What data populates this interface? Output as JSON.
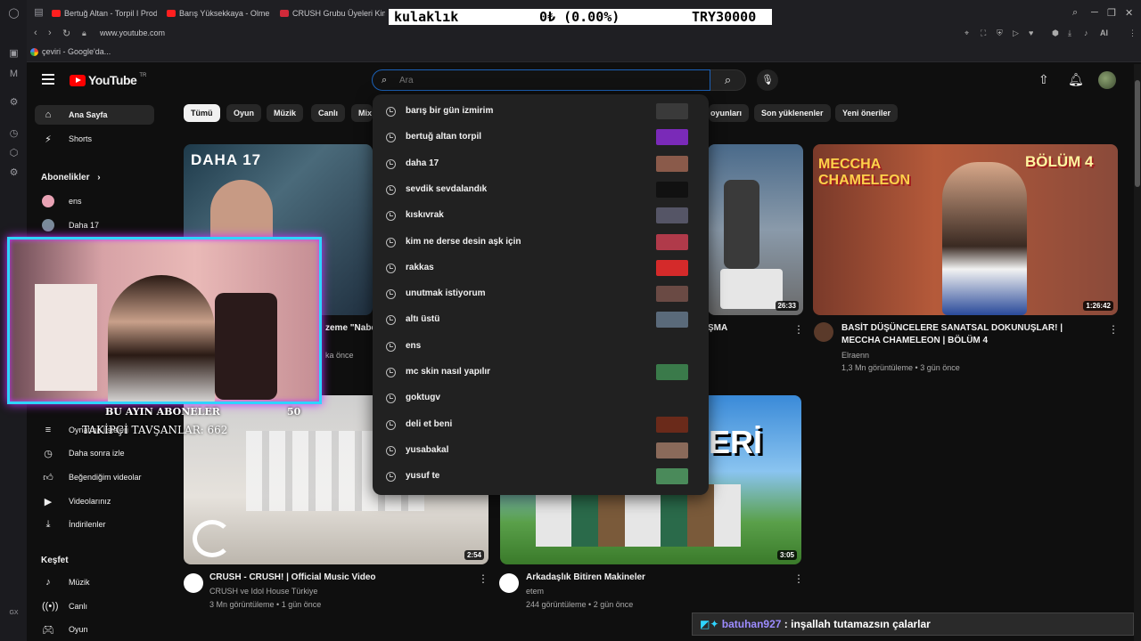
{
  "browser": {
    "tabs": [
      {
        "label": "Bertuğ Altan - Torpil I Prod"
      },
      {
        "label": "Barış Yüksekkaya - Olmeli"
      },
      {
        "label": "CRUSH Grubu Üyeleri Kim"
      }
    ],
    "ticker": {
      "term": "kulaklık",
      "change": "0₺ (0.00%)",
      "price": "TRY30000"
    },
    "url": "www.youtube.com",
    "bookmark": "çeviri - Google'da..."
  },
  "masthead": {
    "logo_text": "YouTube",
    "logo_sup": "TR",
    "search_placeholder": "Ara"
  },
  "sidebar": {
    "main": [
      {
        "label": "Ana Sayfa",
        "icon": "home-icon"
      },
      {
        "label": "Shorts",
        "icon": "shorts-icon"
      }
    ],
    "subs_heading": "Abonelikler",
    "subs": [
      {
        "label": "ens",
        "color": "#e8a2b4"
      },
      {
        "label": "Daha 17",
        "color": "#7a8b9a"
      }
    ],
    "you": [
      {
        "label": "Oynatma listeleri",
        "icon": "playlist-icon"
      },
      {
        "label": "Daha sonra izle",
        "icon": "clock-icon"
      },
      {
        "label": "Beğendiğim videolar",
        "icon": "thumbs-up-icon"
      },
      {
        "label": "Videolarınız",
        "icon": "video-icon"
      },
      {
        "label": "İndirilenler",
        "icon": "download-icon"
      }
    ],
    "explore_heading": "Keşfet",
    "explore": [
      {
        "label": "Müzik",
        "icon": "music-icon"
      },
      {
        "label": "Canlı",
        "icon": "live-icon"
      },
      {
        "label": "Oyun",
        "icon": "game-icon"
      }
    ]
  },
  "chips": {
    "left": [
      "Tümü",
      "Oyun",
      "Müzik",
      "Canlı",
      "Mix"
    ],
    "right": [
      "oyunları",
      "Son yüklenenler",
      "Yeni öneriler"
    ]
  },
  "suggestions": [
    {
      "text": "barış bir gün izmirim",
      "thumb": "#3a3a3a"
    },
    {
      "text": "bertuğ altan torpil",
      "thumb": "#7a2ab8"
    },
    {
      "text": "daha 17",
      "thumb": "#8a5a4a"
    },
    {
      "text": "sevdik sevdalandık",
      "thumb": "#111111"
    },
    {
      "text": "kıskıvrak",
      "thumb": "#555566"
    },
    {
      "text": "kim ne derse desin aşk için",
      "thumb": "#b03a4a"
    },
    {
      "text": "rakkas",
      "thumb": "#d42a2a"
    },
    {
      "text": "unutmak istiyorum",
      "thumb": "#6a4a44"
    },
    {
      "text": "altı üstü",
      "thumb": "#5a6a7a"
    },
    {
      "text": "ens",
      "thumb": ""
    },
    {
      "text": "mc skin nasıl yapılır",
      "thumb": "#3a7a4a"
    },
    {
      "text": "goktugv",
      "thumb": ""
    },
    {
      "text": "deli et beni",
      "thumb": "#6a2a1a"
    },
    {
      "text": "yusabakal",
      "thumb": "#8a6a5a"
    },
    {
      "text": "yusuf te",
      "thumb": "#4a8a5a"
    }
  ],
  "videos": {
    "row1_left": {
      "thumb_text": "DAHA 17",
      "title_fragment": "zeme \"Nabe",
      "meta_fragment": "ka önce"
    },
    "row1_mid": {
      "title_fragment": "ŞMA",
      "duration": "26:33"
    },
    "row1_right": {
      "thumb_text": "MECCHA CHAMELEON",
      "thumb_text2": "BÖLÜM 4",
      "title": "BASİT DÜŞÜNCELERE SANATSAL DOKUNUŞLAR! | MECCHA CHAMELEON | BÖLÜM 4",
      "channel": "Elraenn",
      "meta": "1,3 Mn görüntüleme • 3 gün önce",
      "duration": "1:26:42"
    },
    "row2_left": {
      "title": "CRUSH - CRUSH! | Official Music Video",
      "channel": "CRUSH ve Idol House Türkiye",
      "meta": "3 Mn görüntüleme • 1 gün önce",
      "duration": "2:54"
    },
    "row2_mid": {
      "thumb_text": "ERİ",
      "title": "Arkadaşlık Bitiren Makineler",
      "channel": "etem",
      "meta": "244 görüntüleme • 2 gün önce",
      "duration": "3:05"
    }
  },
  "overlay": {
    "banner": "BU AYIN ABONELER",
    "banner_count": "50",
    "followers": "TAKİPÇİ TAVŞANLAR: 662",
    "chat_user": "batuhan927",
    "chat_msg": ": inşallah tutamazsın çalarlar"
  }
}
